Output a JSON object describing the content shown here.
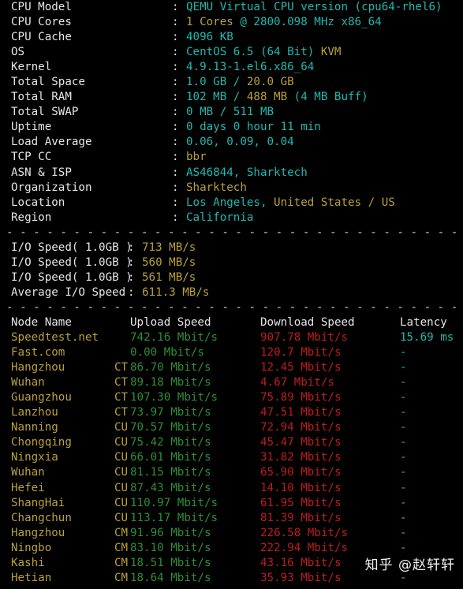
{
  "colors": {
    "background": "#000000",
    "label": "#e6e6e6",
    "cyan": "#1fb9b0",
    "yellow": "#b9a13a",
    "green": "#2f8f34",
    "red": "#c01c1c",
    "divider": "#cfcfcf"
  },
  "system_info": [
    {
      "label": "CPU Model",
      "colon": ":",
      "segments": [
        {
          "text": "QEMU Virtual CPU version (cpu64-rhel6)",
          "color": "cyan"
        }
      ]
    },
    {
      "label": "CPU Cores",
      "colon": ":",
      "segments": [
        {
          "text": "1 Cores",
          "color": "yellow"
        },
        {
          "text": " @ 2800.098 MHz x86_64",
          "color": "cyan"
        }
      ]
    },
    {
      "label": "CPU Cache",
      "colon": ":",
      "segments": [
        {
          "text": "4096 KB",
          "color": "cyan"
        }
      ]
    },
    {
      "label": "OS",
      "colon": ":",
      "segments": [
        {
          "text": "CentOS 6.5 (64 Bit) ",
          "color": "cyan"
        },
        {
          "text": "KVM",
          "color": "yellow"
        }
      ]
    },
    {
      "label": "Kernel",
      "colon": ":",
      "segments": [
        {
          "text": "4.9.13-1.el6.x86_64",
          "color": "cyan"
        }
      ]
    },
    {
      "label": "Total Space",
      "colon": ":",
      "segments": [
        {
          "text": "1.0 GB / ",
          "color": "cyan"
        },
        {
          "text": "20.0 GB",
          "color": "yellow"
        }
      ]
    },
    {
      "label": "Total RAM",
      "colon": ":",
      "segments": [
        {
          "text": "102 MB / ",
          "color": "cyan"
        },
        {
          "text": "488 MB",
          "color": "yellow"
        },
        {
          "text": " (4 MB Buff)",
          "color": "cyan"
        }
      ]
    },
    {
      "label": "Total SWAP",
      "colon": ":",
      "segments": [
        {
          "text": "0 MB / 511 MB",
          "color": "cyan"
        }
      ]
    },
    {
      "label": "Uptime",
      "colon": ":",
      "segments": [
        {
          "text": "0 days 0 hour 11 min",
          "color": "cyan"
        }
      ]
    },
    {
      "label": "Load Average",
      "colon": ":",
      "segments": [
        {
          "text": "0.06, 0.09, 0.04",
          "color": "cyan"
        }
      ]
    },
    {
      "label": "TCP CC",
      "colon": ":",
      "segments": [
        {
          "text": "bbr",
          "color": "yellow"
        }
      ]
    },
    {
      "label": "ASN & ISP",
      "colon": ":",
      "segments": [
        {
          "text": "AS46844, Sharktech",
          "color": "cyan"
        }
      ]
    },
    {
      "label": "Organization",
      "colon": ":",
      "segments": [
        {
          "text": "Sharktech",
          "color": "yellow"
        }
      ]
    },
    {
      "label": "Location",
      "colon": ":",
      "segments": [
        {
          "text": "Los Angeles, ",
          "color": "cyan"
        },
        {
          "text": "United States / US",
          "color": "yellow"
        }
      ]
    },
    {
      "label": "Region",
      "colon": ":",
      "segments": [
        {
          "text": "California",
          "color": "cyan"
        }
      ]
    }
  ],
  "divider_char": "-",
  "io_tests": [
    {
      "label": "I/O Speed( 1.0GB )",
      "colon": ":",
      "value": "713 MB/s"
    },
    {
      "label": "I/O Speed( 1.0GB )",
      "colon": ":",
      "value": "560 MB/s"
    },
    {
      "label": "I/O Speed( 1.0GB )",
      "colon": ":",
      "value": "561 MB/s"
    },
    {
      "label": "Average I/O Speed",
      "colon": ":",
      "value": "611.3 MB/s"
    }
  ],
  "speedtest": {
    "headers": {
      "node": "Node Name",
      "isp": "",
      "upload": "Upload Speed",
      "download": "Download Speed",
      "latency": "Latency"
    },
    "rows": [
      {
        "node": "Speedtest.net",
        "isp": "",
        "upload": "742.16 Mbit/s",
        "download": "907.78 Mbit/s",
        "latency": "15.69 ms"
      },
      {
        "node": "Fast.com",
        "isp": "",
        "upload": "0.00 Mbit/s",
        "download": "120.7 Mbit/s",
        "latency": "-"
      },
      {
        "node": "Hangzhou",
        "isp": "CT",
        "upload": "86.70 Mbit/s",
        "download": "12.45 Mbit/s",
        "latency": "-"
      },
      {
        "node": "Wuhan",
        "isp": "CT",
        "upload": "89.18 Mbit/s",
        "download": "4.67 Mbit/s",
        "latency": "-"
      },
      {
        "node": "Guangzhou",
        "isp": "CT",
        "upload": "107.30 Mbit/s",
        "download": "75.89 Mbit/s",
        "latency": "-"
      },
      {
        "node": "Lanzhou",
        "isp": "CT",
        "upload": "73.97 Mbit/s",
        "download": "47.51 Mbit/s",
        "latency": "-"
      },
      {
        "node": "Nanning",
        "isp": "CU",
        "upload": "70.57 Mbit/s",
        "download": "72.94 Mbit/s",
        "latency": "-"
      },
      {
        "node": "Chongqing",
        "isp": "CU",
        "upload": "75.42 Mbit/s",
        "download": "45.47 Mbit/s",
        "latency": "-"
      },
      {
        "node": "Ningxia",
        "isp": "CU",
        "upload": "66.01 Mbit/s",
        "download": "31.82 Mbit/s",
        "latency": "-"
      },
      {
        "node": "Wuhan",
        "isp": "CU",
        "upload": "81.15 Mbit/s",
        "download": "65.90 Mbit/s",
        "latency": "-"
      },
      {
        "node": "Hefei",
        "isp": "CU",
        "upload": "87.43 Mbit/s",
        "download": "14.10 Mbit/s",
        "latency": "-"
      },
      {
        "node": "ShangHai",
        "isp": "CU",
        "upload": "110.97 Mbit/s",
        "download": "61.95 Mbit/s",
        "latency": "-"
      },
      {
        "node": "Changchun",
        "isp": "CU",
        "upload": "113.17 Mbit/s",
        "download": "81.39 Mbit/s",
        "latency": "-"
      },
      {
        "node": "Hangzhou",
        "isp": "CM",
        "upload": "91.96 Mbit/s",
        "download": "226.58 Mbit/s",
        "latency": "-"
      },
      {
        "node": "Ningbo",
        "isp": "CM",
        "upload": "83.10 Mbit/s",
        "download": "222.94 Mbit/s",
        "latency": "-"
      },
      {
        "node": "Kashi",
        "isp": "CM",
        "upload": "18.51 Mbit/s",
        "download": "43.16 Mbit/s",
        "latency": "-"
      },
      {
        "node": "Hetian",
        "isp": "CM",
        "upload": "18.64 Mbit/s",
        "download": "35.93 Mbit/s",
        "latency": "-"
      }
    ]
  },
  "watermark": "知乎 @赵轩轩"
}
